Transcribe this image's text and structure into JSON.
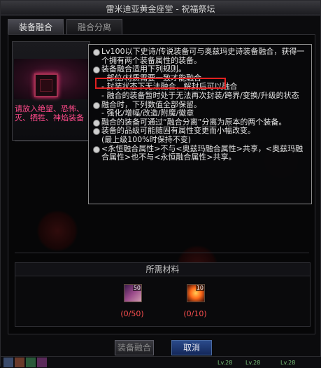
{
  "window": {
    "title": "雷米迪亚黄金座堂 - 祝福祭坛"
  },
  "tabs": [
    {
      "label": "装备融合"
    },
    {
      "label": "融合分离"
    }
  ],
  "slot_panel": {
    "warning": "请放入绝望、恐怖、灭、牺牲、神焰装备"
  },
  "tooltip": {
    "items": [
      {
        "type": "bullet",
        "text": "Lv100以下史诗/传说装备可与奥兹玛史诗装备融合，获得一个拥有两个装备属性的装备。"
      },
      {
        "type": "bullet",
        "text": "装备融合适用下列规则。"
      },
      {
        "type": "sub",
        "text": "- 部位/材质需要一致才能融合"
      },
      {
        "type": "sub",
        "text": "- 封装状态下无法融合，解封后可以融合"
      },
      {
        "type": "sub",
        "text": "- 融合的装备暂时处于无法再次封装/跨界/变换/升级的状态"
      },
      {
        "type": "bullet",
        "text": "融合时，下列数值全部保留。"
      },
      {
        "type": "sub",
        "text": "- 强化/增幅/改造/附魔/徽章"
      },
      {
        "type": "bullet",
        "text": "融合的装备可通过“融合分离”分离为原本的两个装备。"
      },
      {
        "type": "bullet",
        "text": "装备的品级可能随固有属性变更而小幅改变。"
      },
      {
        "type": "sub",
        "text": "(最上级100%时保持不变)"
      },
      {
        "type": "bullet",
        "text": "<永恒融合属性>不与<奥兹玛融合属性>共享，<奥兹玛融合属性>也不与<永恒融合属性>共享。"
      }
    ]
  },
  "materials": {
    "title": "所需材料",
    "items": [
      {
        "icon": "fusion-stone-icon",
        "stack": "50",
        "count": "(0/50)"
      },
      {
        "icon": "flame-orb-icon",
        "stack": "10",
        "count": "(0/10)"
      }
    ]
  },
  "buttons": {
    "fuse": "装备融合",
    "cancel": "取消"
  },
  "taskbar": {
    "levels": [
      "Lv.28",
      "Lv.28",
      "Lv.28"
    ]
  },
  "colors": {
    "warning": "#ff4a8a",
    "highlight": "#e02020",
    "count_red": "#ff5050",
    "cancel_blue": "#2a4a8a"
  }
}
